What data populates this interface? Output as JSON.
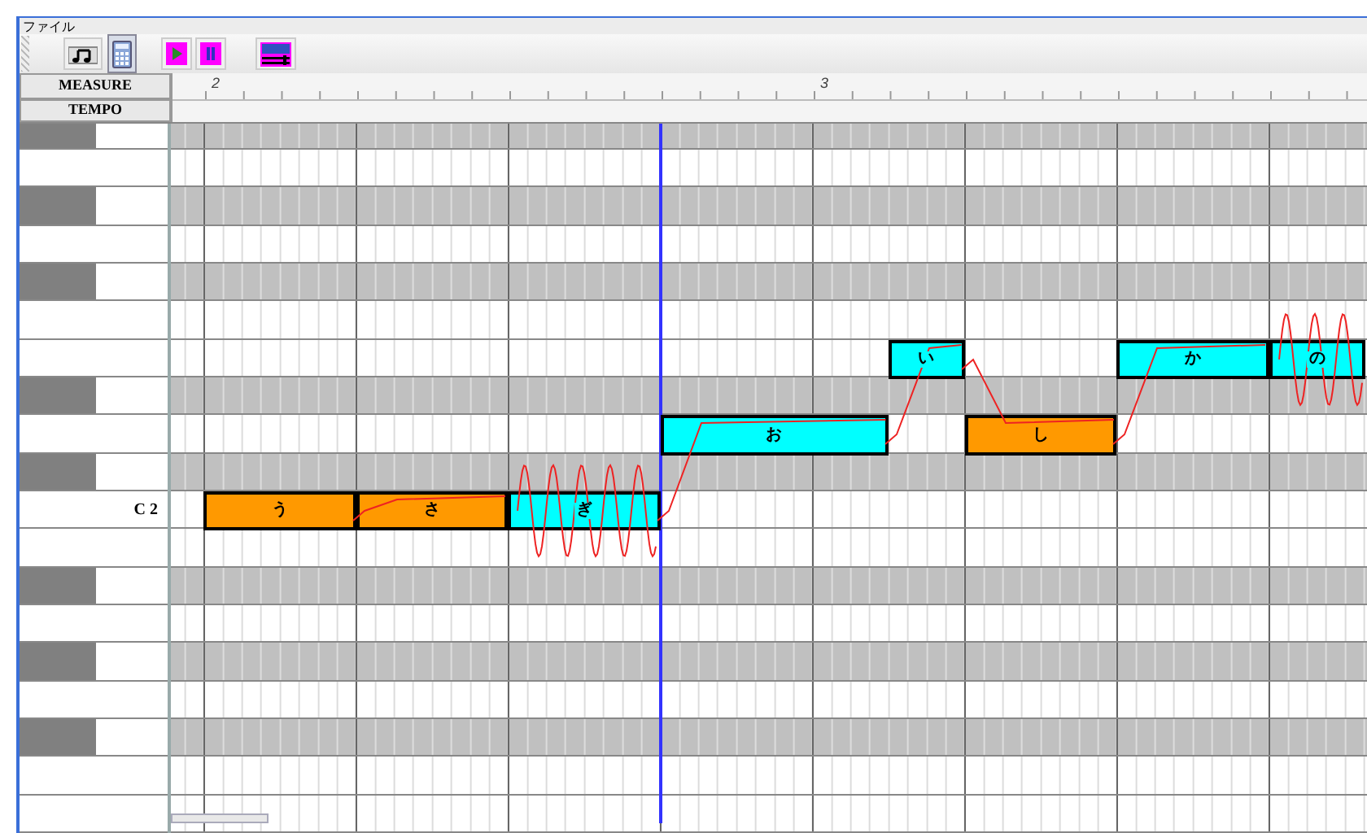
{
  "menu": [
    "ファイル"
  ],
  "toolbar": [
    {
      "kind": "notes",
      "selected": false
    },
    {
      "kind": "calculator",
      "selected": true
    },
    {
      "kind": "play",
      "selected": false
    },
    {
      "kind": "pause",
      "selected": false
    },
    {
      "kind": "mixer",
      "selected": false
    }
  ],
  "header": {
    "measure_label": "MEASURE",
    "tempo_label": "TEMPO",
    "measure_numbers": [
      "2",
      "3"
    ]
  },
  "keys": [
    {
      "kind": "black"
    },
    {
      "kind": "white"
    },
    {
      "kind": "black"
    },
    {
      "kind": "white"
    },
    {
      "kind": "black"
    },
    {
      "kind": "white"
    },
    {
      "kind": "white"
    },
    {
      "kind": "black"
    },
    {
      "kind": "white"
    },
    {
      "kind": "black"
    },
    {
      "kind": "white",
      "label": "C 2"
    },
    {
      "kind": "white"
    },
    {
      "kind": "black"
    },
    {
      "kind": "white"
    },
    {
      "kind": "black"
    },
    {
      "kind": "white"
    },
    {
      "kind": "black"
    },
    {
      "kind": "white"
    },
    {
      "kind": "white"
    }
  ],
  "notes": [
    {
      "lyric": "う",
      "color": "#ff9900",
      "vibrato": false
    },
    {
      "lyric": "さ",
      "color": "#ff9900",
      "vibrato": false
    },
    {
      "lyric": "ぎ",
      "color": "#00ffff",
      "vibrato": true
    },
    {
      "lyric": "お",
      "color": "#00ffff",
      "vibrato": false
    },
    {
      "lyric": "い",
      "color": "#00ffff",
      "vibrato": false
    },
    {
      "lyric": "し",
      "color": "#ff9900",
      "vibrato": false
    },
    {
      "lyric": "か",
      "color": "#00ffff",
      "vibrato": false
    },
    {
      "lyric": "の",
      "color": "#00ffff",
      "vibrato": true
    }
  ]
}
